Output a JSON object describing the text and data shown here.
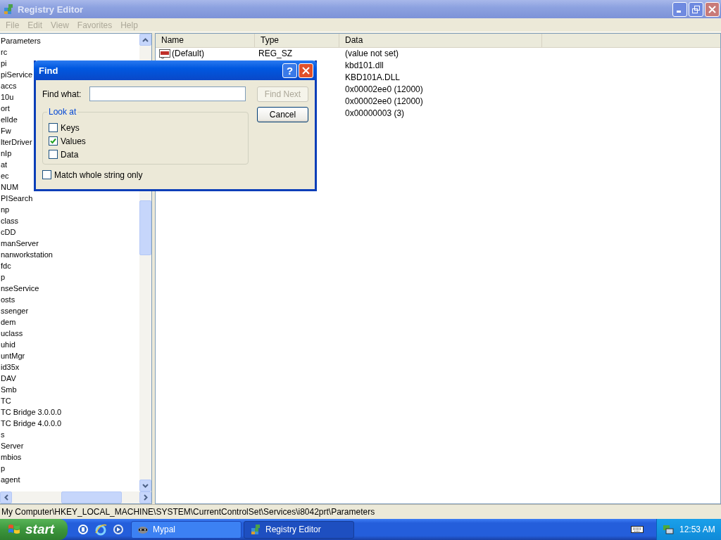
{
  "window": {
    "title": "Registry Editor",
    "active": false
  },
  "menu": [
    {
      "label": "File",
      "disabled": true
    },
    {
      "label": "Edit",
      "disabled": true
    },
    {
      "label": "View",
      "disabled": true
    },
    {
      "label": "Favorites",
      "disabled": true
    },
    {
      "label": "Help",
      "disabled": true
    }
  ],
  "tree": {
    "items": [
      "Parameters",
      "rc",
      "pi",
      "piService",
      "accs",
      "10u",
      "ort",
      "elIde",
      "Fw",
      "lterDriver",
      "nIp",
      "at",
      "ec",
      "NUM",
      "PISearch",
      "np",
      "class",
      "cDD",
      "manServer",
      "nanworkstation",
      "fdc",
      "p",
      "nseService",
      "osts",
      "ssenger",
      "dem",
      "uclass",
      "uhid",
      "untMgr",
      "id35x",
      "DAV",
      "Smb",
      "TC",
      "TC Bridge 3.0.0.0",
      "TC Bridge 4.0.0.0",
      "s",
      "Server",
      "mbios",
      "p",
      "agent"
    ]
  },
  "list": {
    "columns": [
      "Name",
      "Type",
      "Data"
    ],
    "rows": [
      {
        "kind": "string",
        "name": "(Default)",
        "type": "REG_SZ",
        "data": "(value not set)"
      },
      {
        "data": "kbd101.dll"
      },
      {
        "data": "KBD101A.DLL"
      },
      {
        "data": "0x00002ee0 (12000)"
      },
      {
        "data": "0x00002ee0 (12000)"
      },
      {
        "data": "0x00000003 (3)"
      }
    ]
  },
  "status_bar": "My Computer\\HKEY_LOCAL_MACHINE\\SYSTEM\\CurrentControlSet\\Services\\i8042prt\\Parameters",
  "find_dialog": {
    "title": "Find",
    "help": "?",
    "find_what_label": "Find what:",
    "look_at_label": "Look at",
    "options": [
      {
        "label": "Keys",
        "checked": false
      },
      {
        "label": "Values",
        "checked": true
      },
      {
        "label": "Data",
        "checked": false
      }
    ],
    "match_whole": {
      "label": "Match whole string only",
      "checked": false
    },
    "buttons": [
      {
        "label": "Find Next",
        "disabled": true
      },
      {
        "label": "Cancel",
        "disabled": false
      }
    ]
  },
  "taskbar": {
    "start": "start",
    "tasks": [
      {
        "label": "Mypal",
        "selected": false
      },
      {
        "label": "Registry Editor",
        "selected": true
      }
    ],
    "clock": "12:53 AM"
  }
}
